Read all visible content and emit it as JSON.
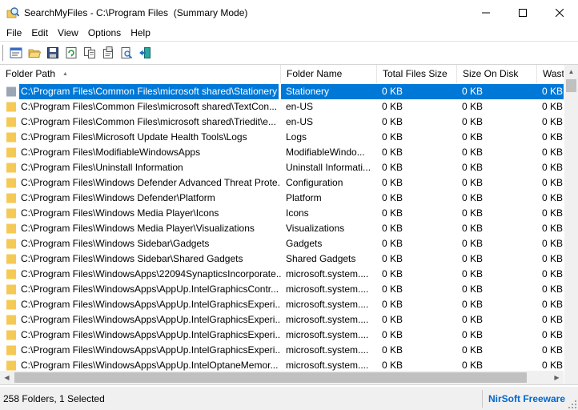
{
  "window": {
    "title": "SearchMyFiles - C:\\Program Files  (Summary Mode)",
    "icon": "magnifier-app-icon",
    "controls": [
      "minimize",
      "maximize",
      "close"
    ]
  },
  "menu": [
    "File",
    "Edit",
    "View",
    "Options",
    "Help"
  ],
  "toolbar": {
    "buttons": [
      "search-options-icon",
      "open-folder-icon",
      "save-icon",
      "refresh-icon",
      "copy-icon",
      "properties-icon",
      "find-icon",
      "exit-icon"
    ]
  },
  "columns": [
    "Folder Path",
    "Folder Name",
    "Total Files Size",
    "Size On Disk",
    "Wast"
  ],
  "sort": {
    "column": "Folder Path",
    "direction": "ascending"
  },
  "rows": [
    {
      "path": "C:\\Program Files\\Common Files\\microsoft shared\\Stationery",
      "name": "Stationery",
      "total": "0 KB",
      "disk": "0 KB",
      "waste": "0 KB",
      "selected": true
    },
    {
      "path": "C:\\Program Files\\Common Files\\microsoft shared\\TextCon...",
      "name": "en-US",
      "total": "0 KB",
      "disk": "0 KB",
      "waste": "0 KB"
    },
    {
      "path": "C:\\Program Files\\Common Files\\microsoft shared\\Triedit\\e...",
      "name": "en-US",
      "total": "0 KB",
      "disk": "0 KB",
      "waste": "0 KB"
    },
    {
      "path": "C:\\Program Files\\Microsoft Update Health Tools\\Logs",
      "name": "Logs",
      "total": "0 KB",
      "disk": "0 KB",
      "waste": "0 KB"
    },
    {
      "path": "C:\\Program Files\\ModifiableWindowsApps",
      "name": "ModifiableWindo...",
      "total": "0 KB",
      "disk": "0 KB",
      "waste": "0 KB"
    },
    {
      "path": "C:\\Program Files\\Uninstall Information",
      "name": "Uninstall Informati...",
      "total": "0 KB",
      "disk": "0 KB",
      "waste": "0 KB"
    },
    {
      "path": "C:\\Program Files\\Windows Defender Advanced Threat Prote...",
      "name": "Configuration",
      "total": "0 KB",
      "disk": "0 KB",
      "waste": "0 KB"
    },
    {
      "path": "C:\\Program Files\\Windows Defender\\Platform",
      "name": "Platform",
      "total": "0 KB",
      "disk": "0 KB",
      "waste": "0 KB"
    },
    {
      "path": "C:\\Program Files\\Windows Media Player\\Icons",
      "name": "Icons",
      "total": "0 KB",
      "disk": "0 KB",
      "waste": "0 KB"
    },
    {
      "path": "C:\\Program Files\\Windows Media Player\\Visualizations",
      "name": "Visualizations",
      "total": "0 KB",
      "disk": "0 KB",
      "waste": "0 KB"
    },
    {
      "path": "C:\\Program Files\\Windows Sidebar\\Gadgets",
      "name": "Gadgets",
      "total": "0 KB",
      "disk": "0 KB",
      "waste": "0 KB"
    },
    {
      "path": "C:\\Program Files\\Windows Sidebar\\Shared Gadgets",
      "name": "Shared Gadgets",
      "total": "0 KB",
      "disk": "0 KB",
      "waste": "0 KB"
    },
    {
      "path": "C:\\Program Files\\WindowsApps\\22094SynapticsIncorporate...",
      "name": "microsoft.system....",
      "total": "0 KB",
      "disk": "0 KB",
      "waste": "0 KB"
    },
    {
      "path": "C:\\Program Files\\WindowsApps\\AppUp.IntelGraphicsContr...",
      "name": "microsoft.system....",
      "total": "0 KB",
      "disk": "0 KB",
      "waste": "0 KB"
    },
    {
      "path": "C:\\Program Files\\WindowsApps\\AppUp.IntelGraphicsExperi...",
      "name": "microsoft.system....",
      "total": "0 KB",
      "disk": "0 KB",
      "waste": "0 KB"
    },
    {
      "path": "C:\\Program Files\\WindowsApps\\AppUp.IntelGraphicsExperi...",
      "name": "microsoft.system....",
      "total": "0 KB",
      "disk": "0 KB",
      "waste": "0 KB"
    },
    {
      "path": "C:\\Program Files\\WindowsApps\\AppUp.IntelGraphicsExperi...",
      "name": "microsoft.system....",
      "total": "0 KB",
      "disk": "0 KB",
      "waste": "0 KB"
    },
    {
      "path": "C:\\Program Files\\WindowsApps\\AppUp.IntelGraphicsExperi...",
      "name": "microsoft.system....",
      "total": "0 KB",
      "disk": "0 KB",
      "waste": "0 KB"
    },
    {
      "path": "C:\\Program Files\\WindowsApps\\AppUp.IntelOptaneMemor...",
      "name": "microsoft.system....",
      "total": "0 KB",
      "disk": "0 KB",
      "waste": "0 KB"
    }
  ],
  "status": {
    "summary": "258 Folders, 1 Selected",
    "brand": "NirSoft Freeware"
  },
  "colors": {
    "selection": "#0078d7",
    "folder": "#f5c956",
    "brand_link": "#0066cc"
  }
}
